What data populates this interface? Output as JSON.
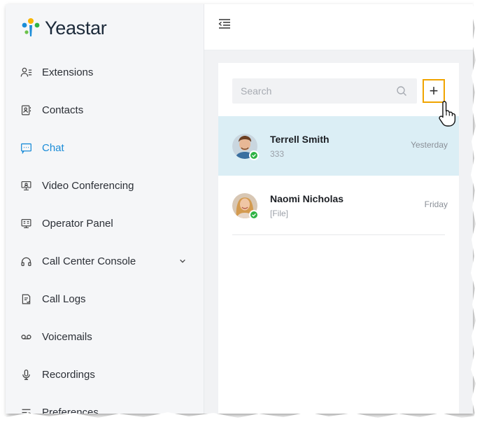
{
  "app": {
    "brand_name": "Yeastar",
    "accent_color": "#1a8cd8",
    "highlight_color": "#f0a400"
  },
  "sidebar": {
    "items": [
      {
        "label": "Extensions",
        "icon": "extensions-icon"
      },
      {
        "label": "Contacts",
        "icon": "contacts-icon"
      },
      {
        "label": "Chat",
        "icon": "chat-icon",
        "active": true
      },
      {
        "label": "Video Conferencing",
        "icon": "video-conferencing-icon"
      },
      {
        "label": "Operator Panel",
        "icon": "operator-panel-icon"
      },
      {
        "label": "Call Center Console",
        "icon": "headset-icon",
        "expandable": true
      },
      {
        "label": "Call Logs",
        "icon": "call-logs-icon"
      },
      {
        "label": "Voicemails",
        "icon": "voicemail-icon"
      },
      {
        "label": "Recordings",
        "icon": "microphone-icon"
      },
      {
        "label": "Preferences",
        "icon": "preferences-icon"
      }
    ]
  },
  "chat_panel": {
    "search_placeholder": "Search",
    "add_button_label": "+",
    "conversations": [
      {
        "name": "Terrell Smith",
        "preview": "333",
        "time": "Yesterday",
        "selected": true,
        "status": "online"
      },
      {
        "name": "Naomi Nicholas",
        "preview": "[File]",
        "time": "Friday",
        "selected": false,
        "status": "online"
      }
    ]
  }
}
